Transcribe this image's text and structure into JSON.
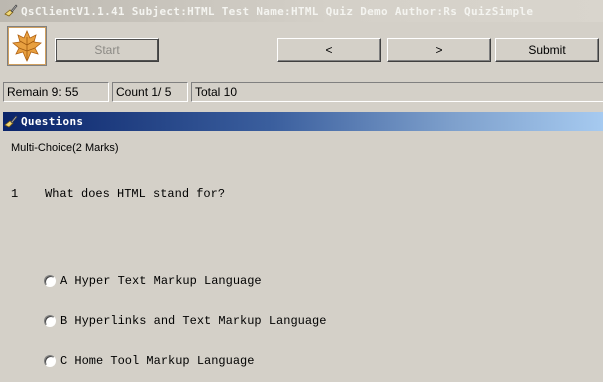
{
  "window": {
    "title": "QsClientV1.1.41 Subject:HTML Test Name:HTML Quiz Demo Author:Rs QuizSimple",
    "icon": "pencil-hand-icon"
  },
  "toolbar": {
    "logo_icon": "maple-leaf-icon",
    "start_label": "Start",
    "start_disabled": true,
    "prev_label": "<",
    "next_label": ">",
    "submit_label": "Submit"
  },
  "status": {
    "remain": "Remain 9: 55",
    "count": "Count 1/ 5",
    "total": "Total 10"
  },
  "questions_panel": {
    "header": "Questions",
    "icon": "pencil-hand-icon",
    "type": "Multi-Choice(2 Marks)",
    "number": "1",
    "text": "What does HTML stand for?",
    "options": [
      {
        "label": "A Hyper Text Markup Language",
        "selected": false
      },
      {
        "label": "B Hyperlinks and Text Markup Language",
        "selected": false
      },
      {
        "label": "C Home Tool Markup Language",
        "selected": false
      }
    ]
  }
}
